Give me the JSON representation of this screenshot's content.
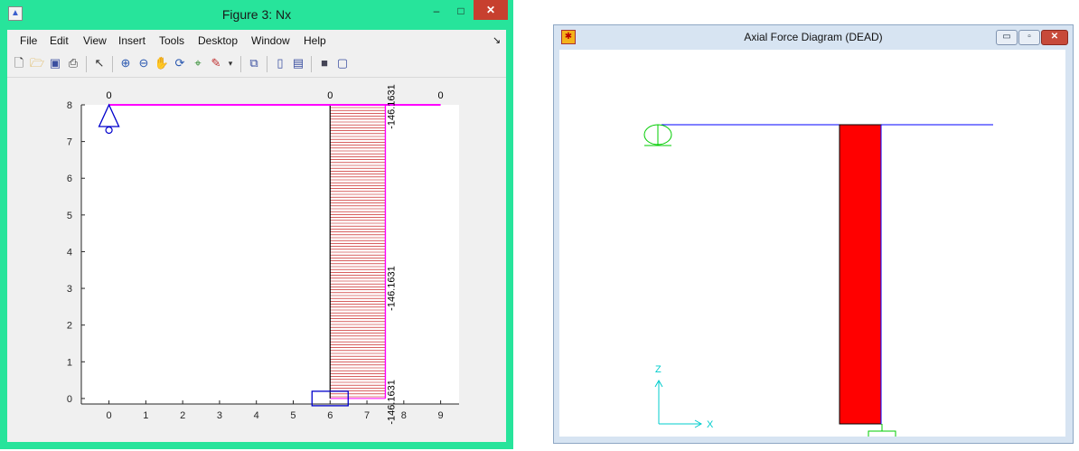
{
  "figure_window": {
    "title": "Figure 3: Nx",
    "app_icon": "matlab-icon",
    "controls": {
      "minimize": "–",
      "maximize": "□",
      "close": "✕"
    },
    "menu": [
      "File",
      "Edit",
      "View",
      "Insert",
      "Tools",
      "Desktop",
      "Window",
      "Help"
    ],
    "menu_overflow": "↘",
    "toolbar_icons": [
      "new-figure-icon",
      "open-file-icon",
      "save-icon",
      "print-icon",
      "edit-plot-arrow-icon",
      "zoom-in-icon",
      "zoom-out-icon",
      "pan-hand-icon",
      "rotate-3d-icon",
      "data-cursor-icon",
      "brush-icon",
      "brush-dropdown-icon",
      "link-plot-icon",
      "colorbar-icon",
      "legend-icon",
      "hide-plot-tools-icon",
      "show-plot-tools-icon"
    ],
    "plot": {
      "x_ticks": [
        "0",
        "1",
        "2",
        "3",
        "4",
        "5",
        "6",
        "7",
        "8",
        "9"
      ],
      "y_ticks": [
        "0",
        "1",
        "2",
        "3",
        "4",
        "5",
        "6",
        "7",
        "8"
      ],
      "xlim": [
        -0.75,
        9.5
      ],
      "ylim": [
        -0.15,
        8
      ],
      "beam_labels": [
        {
          "text": "0",
          "x": 0,
          "y": 8
        },
        {
          "text": "0",
          "x": 6,
          "y": 8
        },
        {
          "text": "0",
          "x": 9,
          "y": 8
        }
      ],
      "column_values": [
        {
          "text": "-146.1631",
          "y": 8
        },
        {
          "text": "-146.1631",
          "y": 3
        },
        {
          "text": "-146.1631",
          "y": 0
        }
      ],
      "beam": {
        "x": [
          0,
          9
        ],
        "y": 8
      },
      "column": {
        "x": 6,
        "y": [
          0,
          8
        ]
      },
      "axial_force": {
        "value": -146.1631,
        "diagram_right_x": 7.5
      },
      "colors": {
        "beam": "#ff00ff",
        "hatch": "#c00000",
        "supports": "#0000cc",
        "column": "#000000"
      }
    }
  },
  "sap_window": {
    "title": "Axial Force Diagram   (DEAD)",
    "app_icon": "sap2000-icon",
    "controls": {
      "minimize": "▭",
      "maximize": "▫",
      "close": "✕"
    },
    "axes": {
      "z_label": "Z",
      "x_label": "X"
    },
    "colors": {
      "beam": "#0000ff",
      "column_fill": "#ff0000",
      "supports": "#00cc00",
      "axes": "#00cccc"
    }
  }
}
